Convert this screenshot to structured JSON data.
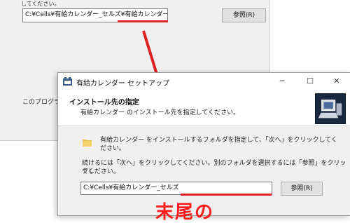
{
  "back_window": {
    "top_text": "してください。",
    "path_value": "C:¥Cells¥有給カレンダー_セルズ¥有給カレンダー",
    "browse_label": "参照(R)",
    "program_text": "このプログラ"
  },
  "dialog": {
    "title": "有給カレンダー セットアップ",
    "minimize": "─",
    "maximize": "☐",
    "close": "✕",
    "header_title": "インストール先の指定",
    "header_sub": "有給カレンダー のインストール先を指定してください。",
    "line1a": "有給カレンダー をインストールするフォルダを指定して、「次へ」をクリックしてく",
    "line1b": "ださい。",
    "line2a": "続けるには「次へ」をクリックしてください。別のフォルダを選択するには「参照」をクリックし",
    "line2b": "てください。",
    "path_value": "C:¥Cells¥有給カレンダー_セルズ",
    "browse_label": "参照(R)"
  },
  "caption": "末尾の",
  "colors": {
    "accent_red": "#e02020",
    "caption_red": "#ff1b1b"
  }
}
